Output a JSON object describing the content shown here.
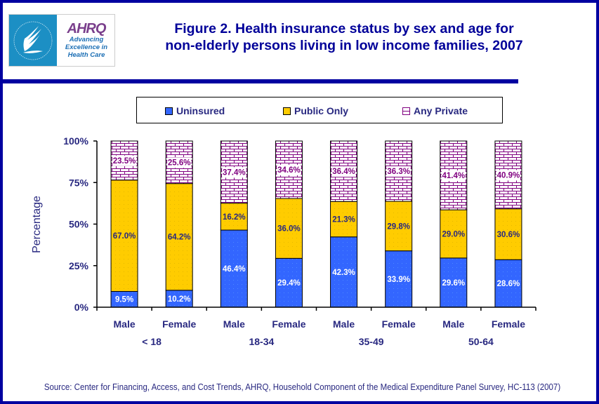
{
  "logo": {
    "hhs_label": "Department of Health & Human Services USA",
    "ahrq_mark": "AHRQ",
    "tagline": [
      "Advancing",
      "Excellence in",
      "Health Care"
    ]
  },
  "title_lines": [
    "Figure 2. Health insurance status by sex and age for",
    "non-elderly persons living in low income families, 2007"
  ],
  "source": "Source: Center for Financing, Access, and Cost Trends, AHRQ, Household Component of the Medical Expenditure Panel Survey, HC-113 (2007)",
  "colors": {
    "frame": "#0000a0",
    "title": "#000099",
    "uninsured": "#3366ff",
    "public_only": "#ffcc00",
    "any_private": "#800080",
    "text": "#282880"
  },
  "chart_data": {
    "type": "bar",
    "stacked": true,
    "title": "Figure 2. Health insurance status by sex and age for non-elderly persons living in low income families, 2007",
    "xlabel": "",
    "ylabel": "Percentage",
    "ylim": [
      0,
      100
    ],
    "yticks": [
      "0%",
      "25%",
      "50%",
      "75%",
      "100%"
    ],
    "ytick_values": [
      0,
      25,
      50,
      75,
      100
    ],
    "legend_position": "top",
    "grid": false,
    "categories": [
      "Male",
      "Female",
      "Male",
      "Female",
      "Male",
      "Female",
      "Male",
      "Female"
    ],
    "groups": [
      {
        "label": "< 18",
        "categories": [
          "Male",
          "Female"
        ]
      },
      {
        "label": "18-34",
        "categories": [
          "Male",
          "Female"
        ]
      },
      {
        "label": "35-49",
        "categories": [
          "Male",
          "Female"
        ]
      },
      {
        "label": "50-64",
        "categories": [
          "Male",
          "Female"
        ]
      }
    ],
    "series": [
      {
        "name": "Uninsured",
        "values": [
          9.5,
          10.2,
          46.4,
          29.4,
          42.3,
          33.9,
          29.6,
          28.6
        ],
        "labels": [
          "9.5%",
          "10.2%",
          "46.4%",
          "29.4%",
          "42.3%",
          "33.9%",
          "29.6%",
          "28.6%"
        ]
      },
      {
        "name": "Public Only",
        "values": [
          67.0,
          64.2,
          16.2,
          36.0,
          21.3,
          29.8,
          29.0,
          30.6
        ],
        "labels": [
          "67.0%",
          "64.2%",
          "16.2%",
          "36.0%",
          "21.3%",
          "29.8%",
          "29.0%",
          "30.6%"
        ]
      },
      {
        "name": "Any Private",
        "values": [
          23.5,
          25.6,
          37.4,
          34.6,
          36.4,
          36.3,
          41.4,
          40.9
        ],
        "labels": [
          "23.5%",
          "25.6%",
          "37.4%",
          "34.6%",
          "36.4%",
          "36.3%",
          "41.4%",
          "40.9%"
        ]
      }
    ]
  }
}
